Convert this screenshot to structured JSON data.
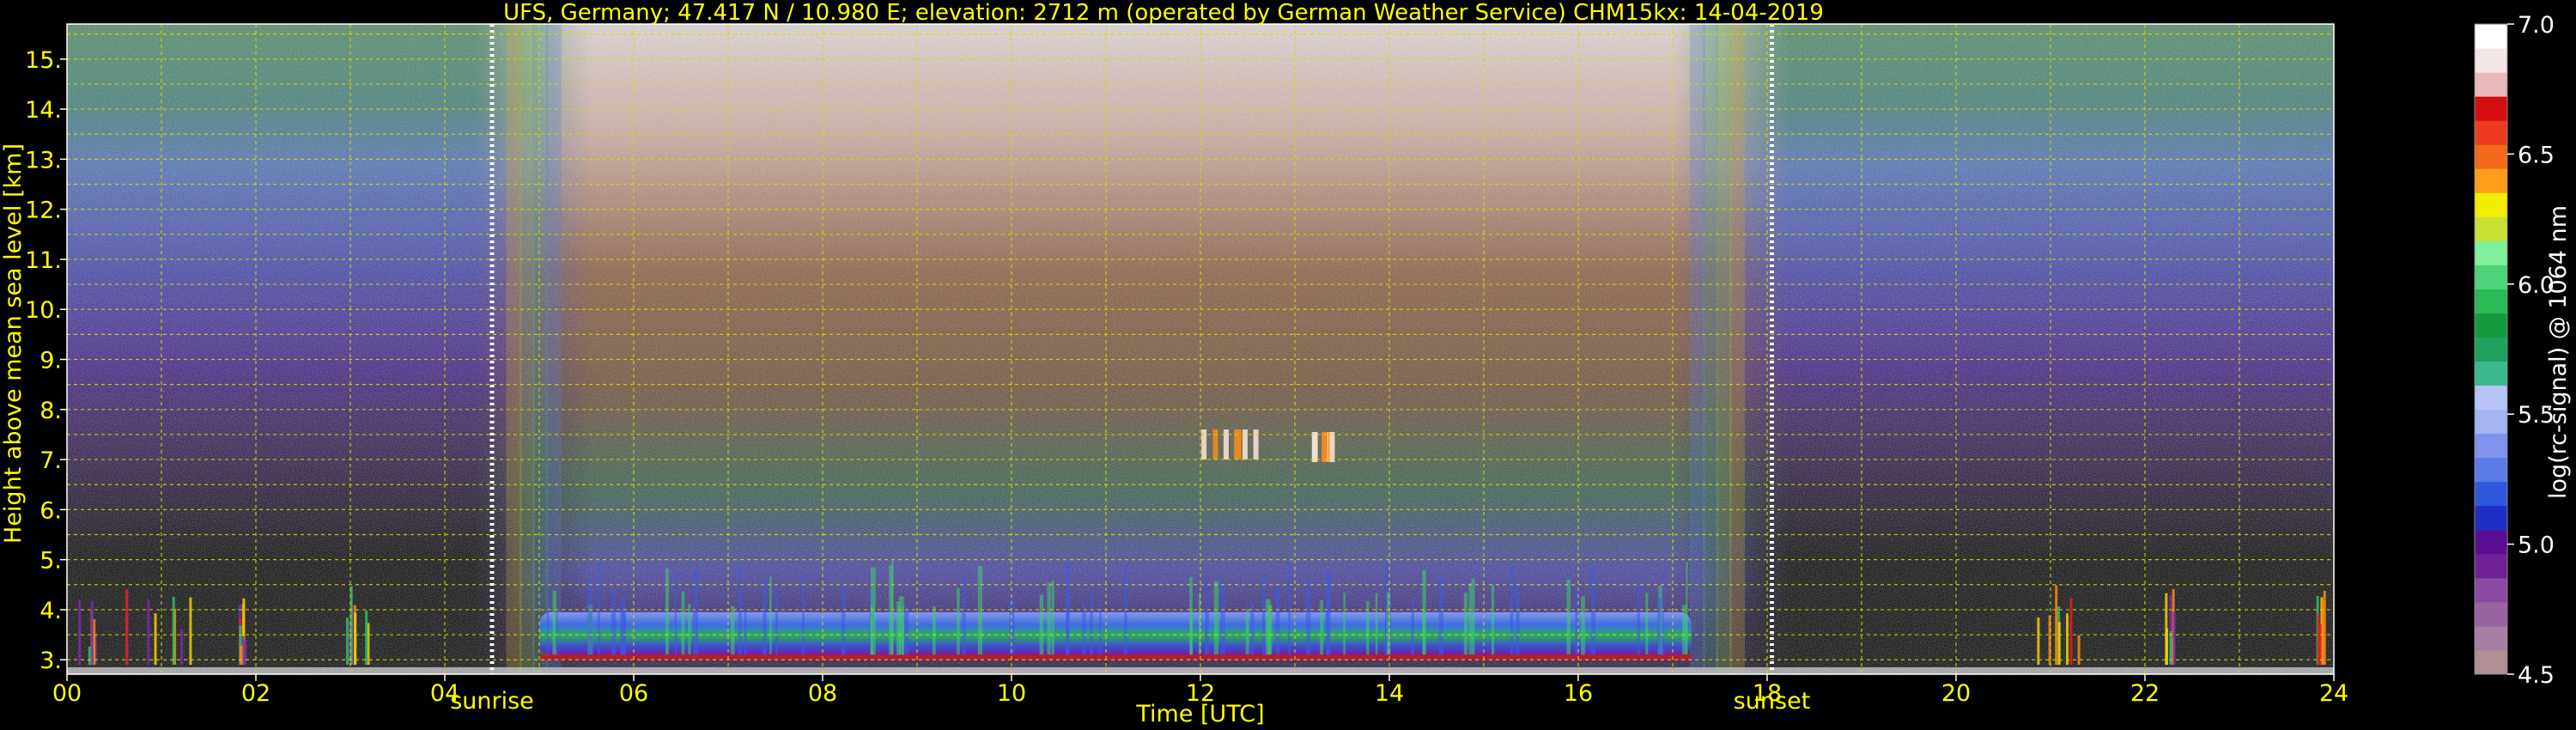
{
  "chart_data": {
    "type": "heatmap",
    "title": "UFS, Germany; 47.417 N / 10.980 E; elevation: 2712 m  (operated by German Weather Service)    CHM15kx: 14-04-2019",
    "xlabel": "Time [UTC]",
    "ylabel": "Height above mean sea level [km]",
    "xlim": [
      0,
      24
    ],
    "ylim": [
      2.712,
      15.7
    ],
    "x_ticks": [
      "00",
      "02",
      "04",
      "06",
      "08",
      "10",
      "12",
      "14",
      "16",
      "18",
      "20",
      "22",
      "24"
    ],
    "y_ticks": [
      "3.",
      "4.",
      "5.",
      "6.",
      "7.",
      "8.",
      "9.",
      "10.",
      "11.",
      "12.",
      "13.",
      "14.",
      "15."
    ],
    "grid": true,
    "colorbar": {
      "label": "log(rc-signal) @ 1064 nm",
      "range": [
        4.5,
        7.0
      ],
      "ticks": [
        "4.5",
        "5.0",
        "5.5",
        "6.0",
        "6.5",
        "7.0"
      ],
      "colors": [
        "#b08f94",
        "#a67fa0",
        "#9a63a2",
        "#8a4ba0",
        "#6f2295",
        "#5a0f92",
        "#1d2fc6",
        "#2f57e0",
        "#5a7be8",
        "#7f93ef",
        "#a4b4f4",
        "#b8c4f8",
        "#3cb88f",
        "#1fa061",
        "#159a40",
        "#2bba55",
        "#4fd37a",
        "#7ff09c",
        "#c7e033",
        "#f2ee00",
        "#ff9d1a",
        "#f26a1b",
        "#ee3a20",
        "#d60e10",
        "#e8b9bb",
        "#f4e6e6",
        "#ffffff"
      ]
    },
    "annotations": [
      {
        "text": "sunrise",
        "x": 4.5
      },
      {
        "text": "sunset",
        "x": 18.05
      }
    ],
    "features": [
      {
        "name": "boundary layer aerosol",
        "x_range": [
          5.0,
          17.2
        ],
        "height_km": 3.5
      },
      {
        "name": "cloud",
        "x_range": [
          11.9,
          12.6
        ],
        "height_km": 7.35
      },
      {
        "name": "cloud",
        "x_range": [
          13.1,
          13.4
        ],
        "height_km": 7.3
      }
    ]
  },
  "colors": {
    "text": "#ffff00",
    "white_text": "#ffffff",
    "grid": "#d8d800",
    "sun_markers": "#ffffff"
  }
}
